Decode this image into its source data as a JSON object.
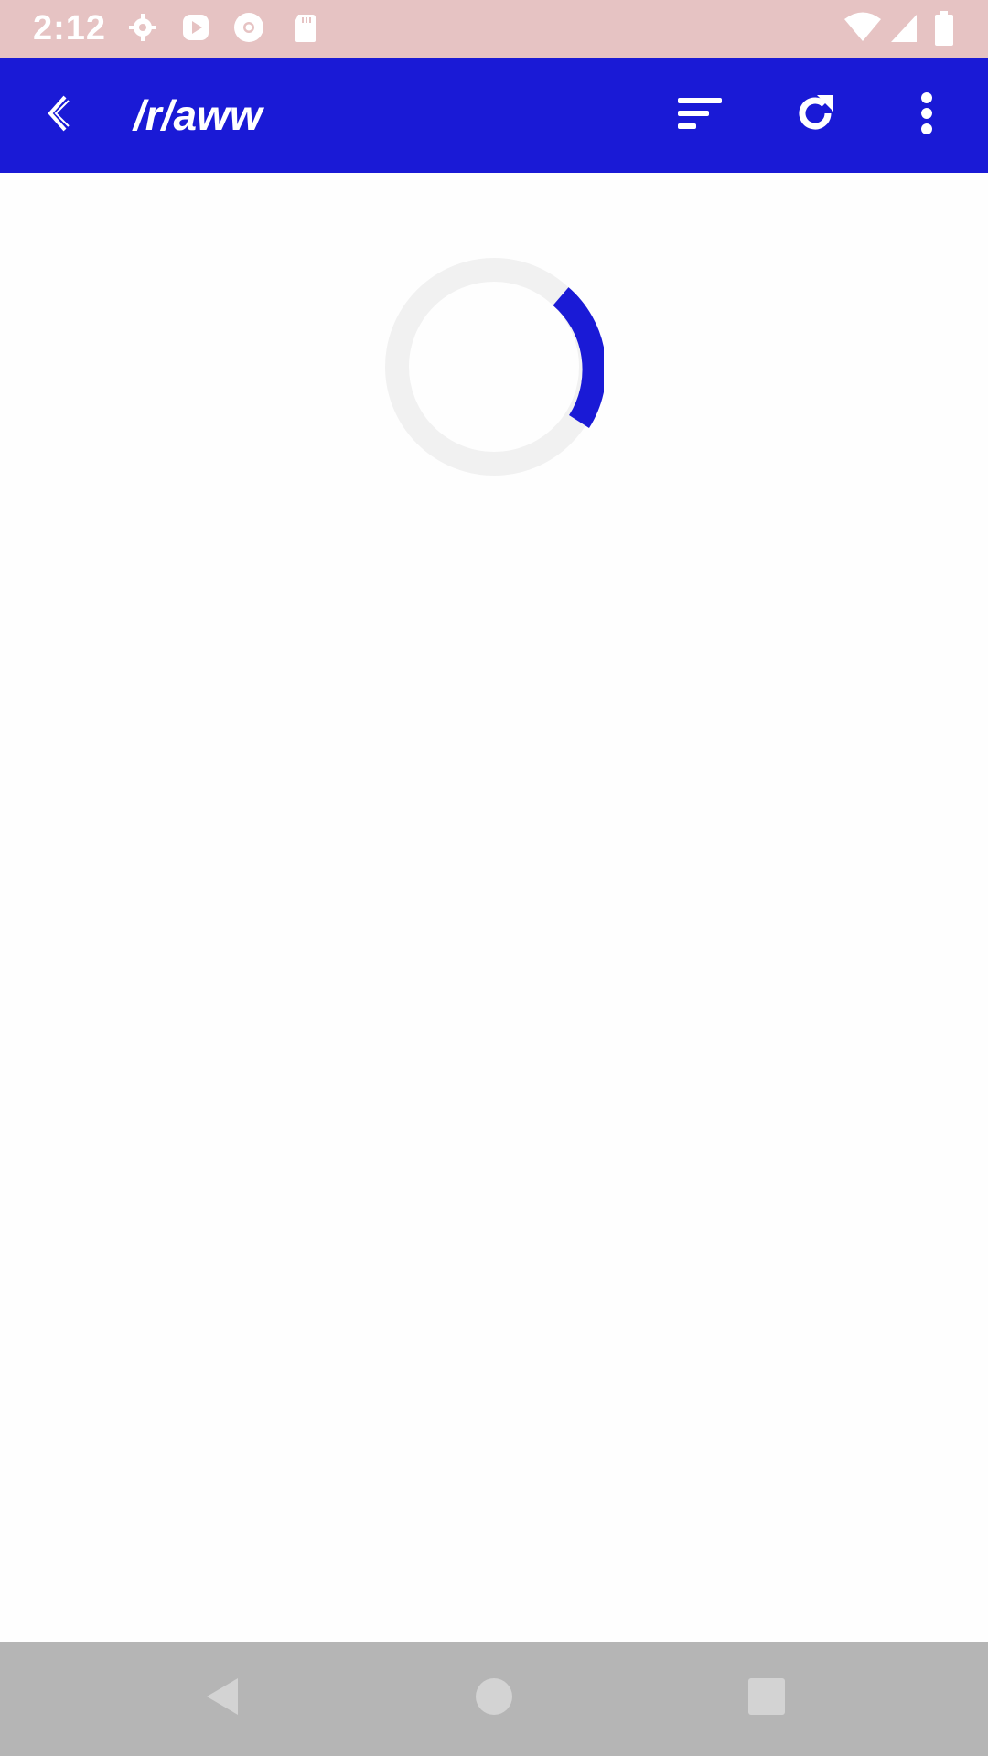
{
  "status_bar": {
    "time": "2:12",
    "notification_icons": [
      "settings-icon",
      "play-store-icon",
      "chrome-icon",
      "sd-card-icon"
    ],
    "system_icons": [
      "wifi-icon",
      "signal-icon",
      "battery-icon"
    ]
  },
  "app_bar": {
    "title": "/r/aww",
    "back_icon": "back-arrow-icon",
    "actions": [
      "sort-icon",
      "refresh-icon",
      "more-vert-icon"
    ]
  },
  "content": {
    "loading": true,
    "spinner_icon": "loading-spinner-icon"
  },
  "nav_bar": {
    "buttons": [
      "nav-back-icon",
      "nav-home-icon",
      "nav-recents-icon"
    ]
  },
  "colors": {
    "status_bar": "#e6c3c3",
    "app_bar": "#1a1ad6",
    "accent": "#1a1ad6",
    "nav_bar": "#b5b5b5",
    "background": "#fefefe"
  }
}
